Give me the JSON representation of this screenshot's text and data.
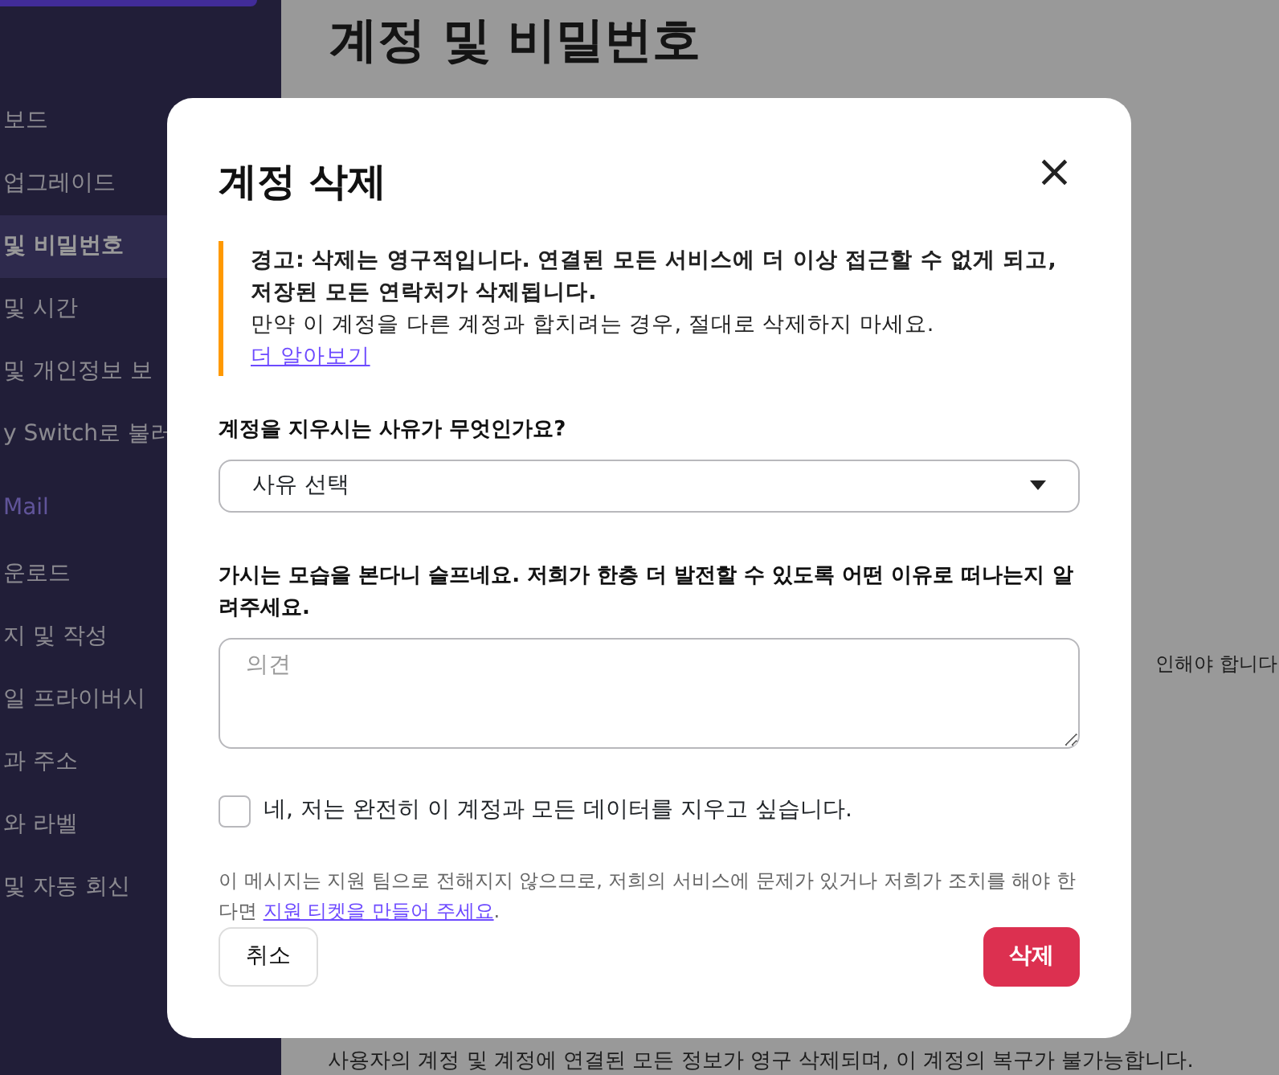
{
  "sidebar": {
    "items": [
      {
        "kind": "item",
        "label": "보드",
        "selected": false
      },
      {
        "kind": "item",
        "label": "업그레이드",
        "selected": false
      },
      {
        "kind": "item",
        "label": "및 비밀번호",
        "selected": true
      },
      {
        "kind": "item",
        "label": "및 시간",
        "selected": false
      },
      {
        "kind": "item",
        "label": "및 개인정보 보",
        "selected": false
      },
      {
        "kind": "item",
        "label": "y Switch로 불러",
        "selected": false
      },
      {
        "kind": "heading",
        "label": "Mail"
      },
      {
        "kind": "item",
        "label": "운로드",
        "selected": false
      },
      {
        "kind": "item",
        "label": "지 및 작성",
        "selected": false
      },
      {
        "kind": "item",
        "label": "일 프라이버시",
        "selected": false
      },
      {
        "kind": "item",
        "label": "과 주소",
        "selected": false
      },
      {
        "kind": "item",
        "label": "와 라벨",
        "selected": false
      },
      {
        "kind": "item",
        "label": "및 자동 회신",
        "selected": false
      }
    ]
  },
  "page": {
    "title": "계정 및 비밀번호",
    "note": "인해야 합니다",
    "footer": "사용자의 계정 및 계정에 연결된 모든 정보가 영구 삭제되며, 이 계정의 복구가 불가능합니다."
  },
  "dialog": {
    "title": "계정 삭제",
    "close": "×",
    "warning": {
      "bold": "경고: 삭제는 영구적입니다. 연결된 모든 서비스에 더 이상 접근할 수 없게 되고, 저장된 모든 연락처가 삭제됩니다.",
      "text": "만약 이 계정을 다른 계정과 합치려는 경우, 절대로 삭제하지 마세요.",
      "link": "더 알아보기"
    },
    "reason": {
      "label": "계정을 지우시는 사유가 무엇인가요?",
      "value": "사유 선택"
    },
    "feedback": {
      "label": "가시는 모습을 본다니 슬프네요. 저희가 한층 더 발전할 수 있도록 어떤 이유로 떠나는지 알려주세요.",
      "placeholder": "의견"
    },
    "confirm": {
      "label": "네, 저는 완전히 이 계정과 모든 데이터를 지우고 싶습니다.",
      "checked": false
    },
    "note": {
      "text": "이 메시지는 지원 팀으로 전해지지 않으므로, 저희의 서비스에 문제가 있거나 저희가 조치를 해야 한다면 ",
      "link": "지원 티켓을 만들어 주세요",
      "end": "."
    },
    "buttons": [
      {
        "kind": "cancel",
        "label": "취소"
      },
      {
        "kind": "danger",
        "label": "삭제"
      }
    ]
  }
}
